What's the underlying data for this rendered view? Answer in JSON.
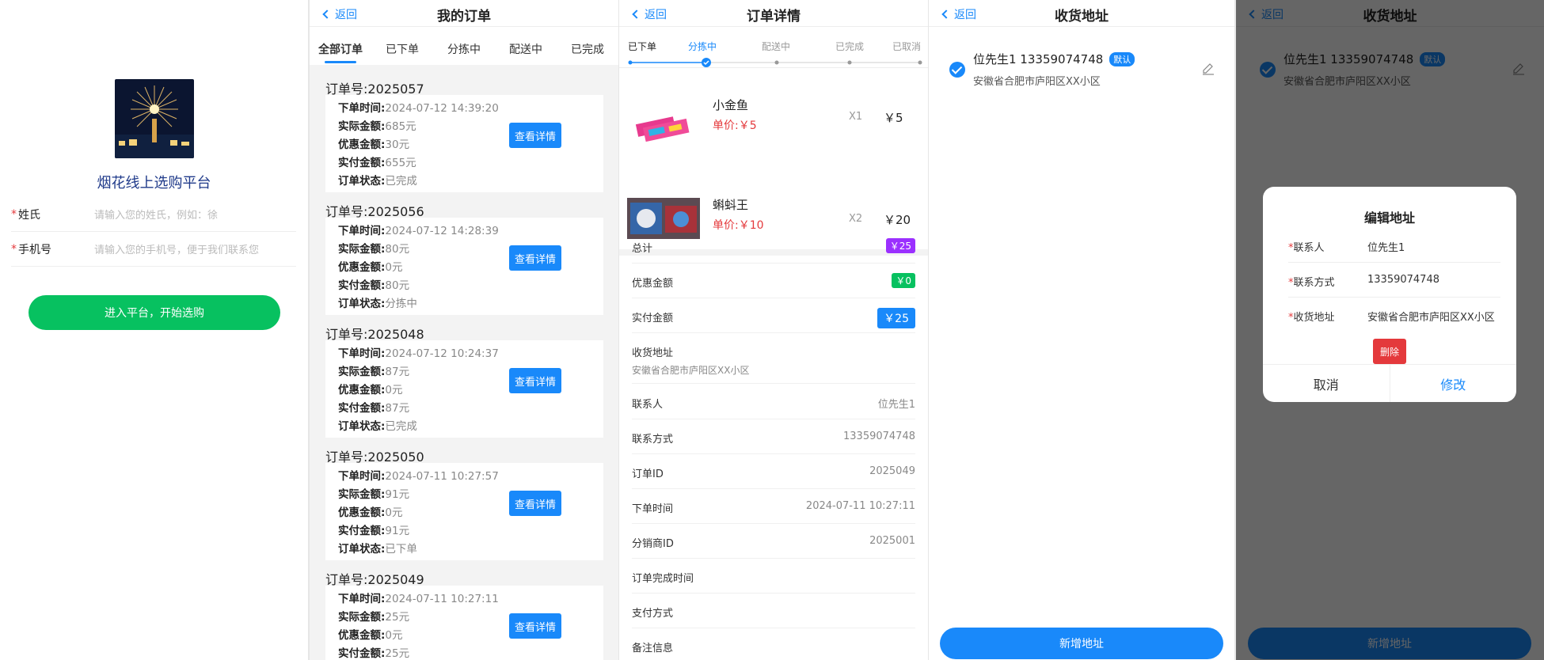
{
  "common": {
    "back_label": "返回"
  },
  "login": {
    "brand": "烟花线上选购平台",
    "name_label": "姓氏",
    "name_placeholder": "请输入您的姓氏，例如：徐",
    "phone_label": "手机号",
    "phone_placeholder": "请输入您的手机号，便于我们联系您",
    "enter_button": "进入平台，开始选购"
  },
  "orders": {
    "title": "我的订单",
    "tabs": [
      "全部订单",
      "已下单",
      "分拣中",
      "配送中",
      "已完成"
    ],
    "labels": {
      "order_no": "订单号:",
      "time": "下单时间:",
      "actual": "实际金额:",
      "discount": "优惠金额:",
      "paid": "实付金额:",
      "status": "订单状态:",
      "view": "查看详情"
    },
    "items": [
      {
        "no": "2025057",
        "time": "2024-07-12 14:39:20",
        "actual": "685元",
        "discount": "30元",
        "paid": "655元",
        "status": "已完成"
      },
      {
        "no": "2025056",
        "time": "2024-07-12 14:28:39",
        "actual": "80元",
        "discount": "0元",
        "paid": "80元",
        "status": "分拣中"
      },
      {
        "no": "2025048",
        "time": "2024-07-12 10:24:37",
        "actual": "87元",
        "discount": "0元",
        "paid": "87元",
        "status": "已完成"
      },
      {
        "no": "2025050",
        "time": "2024-07-11 10:27:57",
        "actual": "91元",
        "discount": "0元",
        "paid": "91元",
        "status": "已下单"
      },
      {
        "no": "2025049",
        "time": "2024-07-11 10:27:11",
        "actual": "25元",
        "discount": "0元",
        "paid": "25元",
        "status": ""
      }
    ]
  },
  "detail": {
    "title": "订单详情",
    "steps": [
      "已下单",
      "分拣中",
      "配送中",
      "已完成",
      "已取消"
    ],
    "products": [
      {
        "name": "小金鱼",
        "price": "单价:￥5",
        "qty": "X1",
        "amount": "￥5"
      },
      {
        "name": "蝌蚪王",
        "price": "单价:￥10",
        "qty": "X2",
        "amount": "￥20"
      }
    ],
    "total_label": "总计",
    "total": "￥25",
    "discount_label": "优惠金额",
    "discount": "￥0",
    "paid_label": "实付金额",
    "paid": "￥25",
    "address_label": "收货地址",
    "address": "安徽省合肥市庐阳区XX小区",
    "rows": [
      {
        "k": "联系人",
        "v": "位先生1"
      },
      {
        "k": "联系方式",
        "v": "13359074748"
      },
      {
        "k": "订单ID",
        "v": "2025049"
      },
      {
        "k": "下单时间",
        "v": "2024-07-11 10:27:11"
      },
      {
        "k": "分销商ID",
        "v": "2025001"
      },
      {
        "k": "订单完成时间",
        "v": ""
      },
      {
        "k": "支付方式",
        "v": ""
      },
      {
        "k": "备注信息",
        "v": ""
      }
    ],
    "colors": {
      "total": "#9b30ff",
      "discount": "#07c160",
      "paid": "#1989fa"
    }
  },
  "address": {
    "title": "收货地址",
    "name_phone": "位先生1 13359074748",
    "default_tag": "默认",
    "detail": "安徽省合肥市庐阳区XX小区",
    "add_button": "新增地址"
  },
  "edit_dialog": {
    "title": "编辑地址",
    "contact_label": "联系人",
    "contact": "位先生1",
    "phone_label": "联系方式",
    "phone": "13359074748",
    "address_label": "收货地址",
    "address": "安徽省合肥市庐阳区XX小区",
    "delete": "删除",
    "cancel": "取消",
    "confirm": "修改"
  }
}
